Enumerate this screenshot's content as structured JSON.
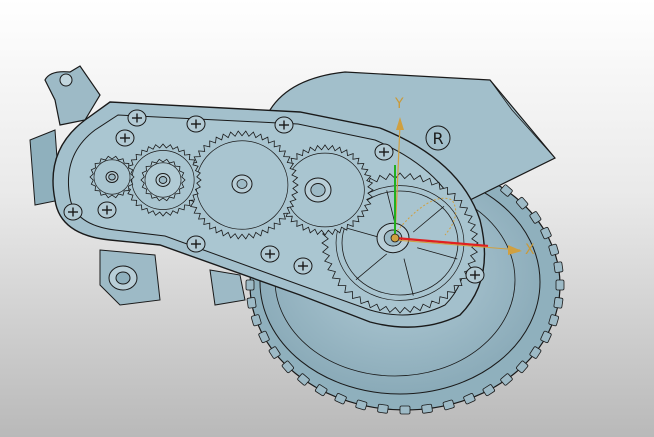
{
  "viewport": {
    "background_top": "#ffffff",
    "background_bottom": "#b9b9b9"
  },
  "model": {
    "part_color": "#9fbcc8",
    "edge_color": "#1a1a1a",
    "emblem": "R"
  },
  "triad": {
    "x_label": "X",
    "y_label": "Y",
    "x_color": "#e02020",
    "y_color": "#d0a040",
    "z_color": "#20b020"
  }
}
